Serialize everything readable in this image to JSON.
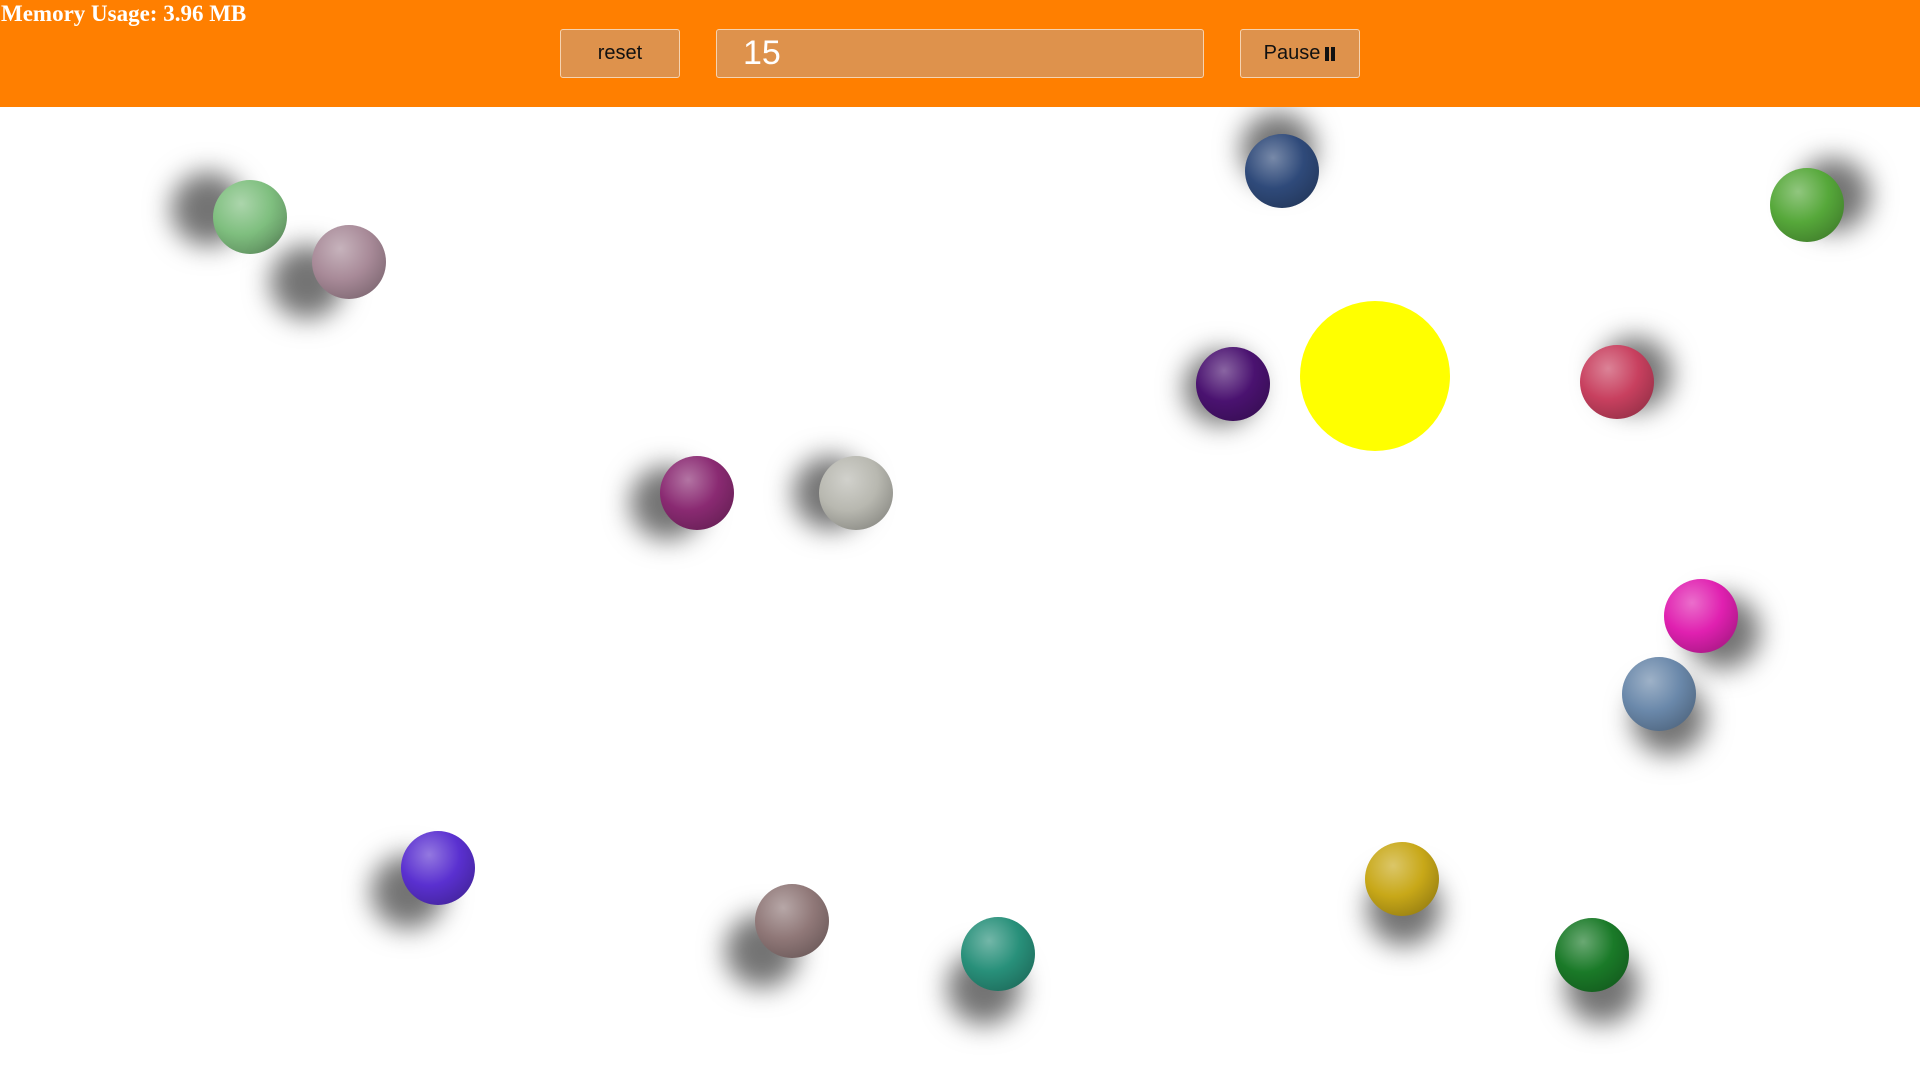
{
  "header": {
    "memory_label": "Memory Usage: 3.96 MB",
    "reset_label": "reset",
    "count_value": "15",
    "pause_label": "Pause",
    "pause_icon": "pause-icon",
    "bar_color": "#ff7f00"
  },
  "stage": {
    "sun_color": "#ffff00",
    "ball_colors": [
      "#7fbf7f",
      "#a88a98",
      "#2f4a7a",
      "#56a83a",
      "#4a1270",
      "#c8405f",
      "#8a2a72",
      "#b8b8b0",
      "#e020b0",
      "#6a88aa",
      "#5a30d0",
      "#907878",
      "#28907a",
      "#c8a818",
      "#1a7a28"
    ]
  }
}
